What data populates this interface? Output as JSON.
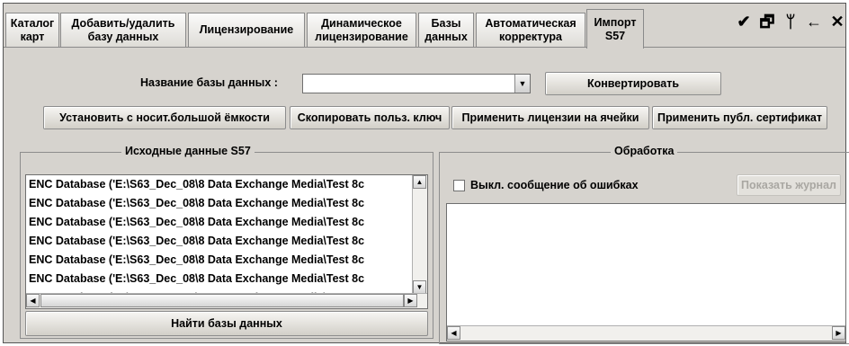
{
  "tabs": [
    {
      "label": "Каталог\nкарт",
      "active": false
    },
    {
      "label": "Добавить/удалить\nбазу данных",
      "active": false
    },
    {
      "label": "Лицензирование",
      "active": false
    },
    {
      "label": "Динамическое\nлицензирование",
      "active": false
    },
    {
      "label": "Базы\nданных",
      "active": false
    },
    {
      "label": "Автоматическая\nкорректура",
      "active": false
    },
    {
      "label": "Импорт\nS57",
      "active": true
    }
  ],
  "window_icons": [
    "broom-icon",
    "restore-window-icon",
    "pin-icon",
    "back-arrow-icon",
    "close-icon"
  ],
  "window_glyphs": {
    "broom": "✔",
    "restore": "🗗",
    "pin": "ᛘ",
    "back": "←",
    "close": "✕"
  },
  "database_name": {
    "label": "Название базы данных :",
    "value": ""
  },
  "buttons": {
    "convert": "Конвертировать",
    "install_large_media": "Установить с носит.большой ёмкости",
    "copy_user_key": "Скопировать польз. ключ",
    "apply_licenses": "Применить лицензии на ячейки",
    "apply_public_cert": "Применить публ. сертификат",
    "find_databases": "Найти базы данных",
    "show_log": "Показать журнал"
  },
  "source_group": {
    "title": "Исходные данные S57",
    "items": [
      "ENC Database ('E:\\S63_Dec_08\\8 Data Exchange Media\\Test 8c",
      "ENC Database ('E:\\S63_Dec_08\\8 Data Exchange Media\\Test 8c",
      "ENC Database ('E:\\S63_Dec_08\\8 Data Exchange Media\\Test 8c",
      "ENC Database ('E:\\S63_Dec_08\\8 Data Exchange Media\\Test 8c",
      "ENC Database ('E:\\S63_Dec_08\\8 Data Exchange Media\\Test 8c",
      "ENC Database ('E:\\S63_Dec_08\\8 Data Exchange Media\\Test 8c",
      "ENC Database ('E:\\S63_Dec_08\\8 Data Exchange Media\\Test 8c"
    ]
  },
  "processing_group": {
    "title": "Обработка",
    "disable_errors_label": "Выкл. сообщение об ошибках",
    "disable_errors_checked": false
  },
  "colors": {
    "background": "#d6d3ce",
    "disabled_text": "#a9a7a2"
  }
}
